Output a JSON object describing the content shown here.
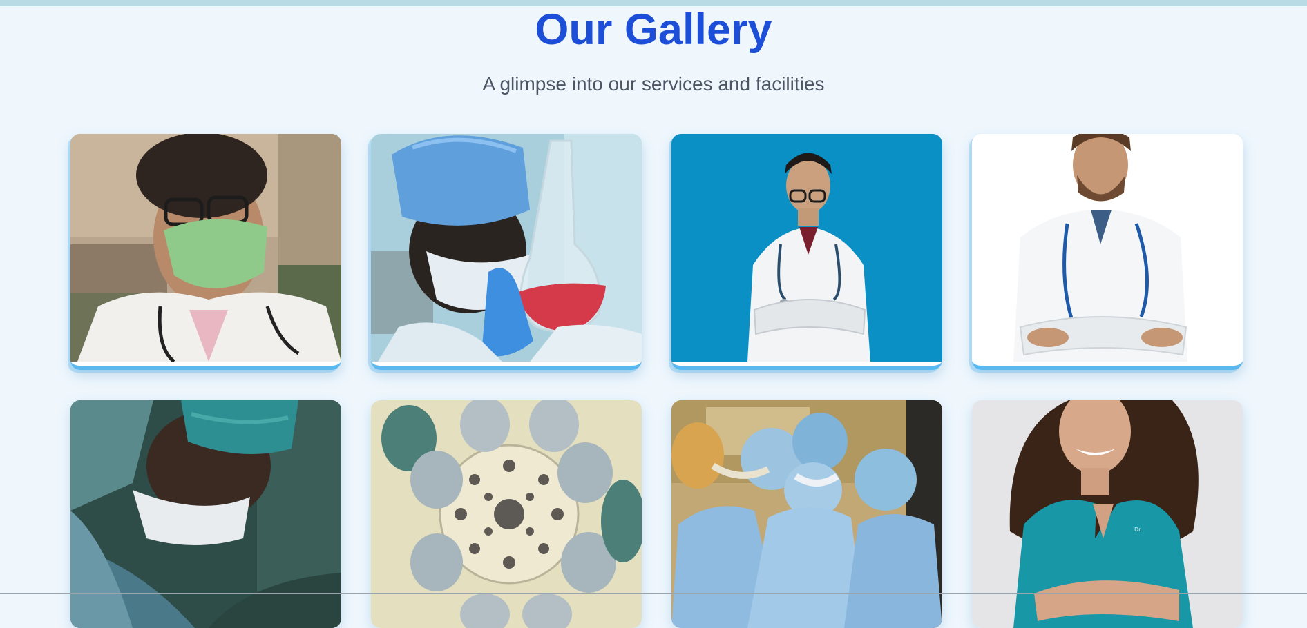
{
  "header": {
    "title": "Our Gallery",
    "subtitle": "A glimpse into our services and facilities"
  },
  "gallery": {
    "items": [
      {
        "icon": "masked-doctor-photo"
      },
      {
        "icon": "lab-scientist-flask-photo"
      },
      {
        "icon": "doctor-blue-background-photo"
      },
      {
        "icon": "doctor-white-background-photo"
      },
      {
        "icon": "surgeon-closeup-photo"
      },
      {
        "icon": "surgical-team-looking-down-photo"
      },
      {
        "icon": "operating-room-team-photo"
      },
      {
        "icon": "nurse-teal-scrubs-photo"
      }
    ]
  },
  "colors": {
    "background": "#eff7fd",
    "title": "#1d4ed8",
    "subtitle": "#4b5563",
    "accent": "#5ab8ee"
  }
}
